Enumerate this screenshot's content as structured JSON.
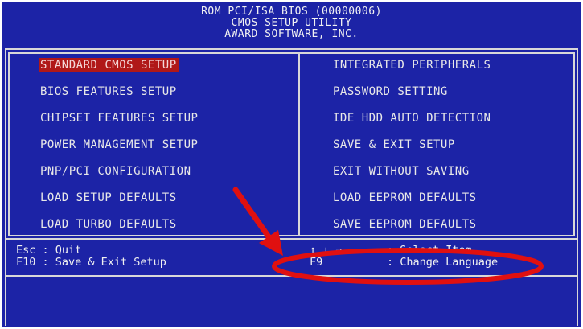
{
  "header": {
    "line1": "ROM PCI/ISA BIOS (00000006)",
    "line2": "CMOS SETUP UTILITY",
    "line3": "AWARD SOFTWARE, INC."
  },
  "menu": {
    "left": [
      "STANDARD CMOS SETUP",
      "BIOS FEATURES SETUP",
      "CHIPSET FEATURES SETUP",
      "POWER MANAGEMENT SETUP",
      "PNP/PCI CONFIGURATION",
      "LOAD SETUP DEFAULTS",
      "LOAD TURBO DEFAULTS"
    ],
    "right": [
      "INTEGRATED PERIPHERALS",
      "PASSWORD SETTING",
      "IDE HDD AUTO DETECTION",
      "SAVE & EXIT SETUP",
      "EXIT WITHOUT SAVING",
      "LOAD EEPROM DEFAULTS",
      "SAVE EEPROM DEFAULTS"
    ]
  },
  "help": {
    "esc": "Esc : Quit",
    "f10": "F10 : Save & Exit Setup",
    "arrows": "↑ ↓ → ←",
    "select": ": Select Item",
    "f9": "F9",
    "language": ": Change Language"
  },
  "colors": {
    "background": "#1c23a6",
    "selected": "#b01818",
    "annotation": "#e01010"
  }
}
